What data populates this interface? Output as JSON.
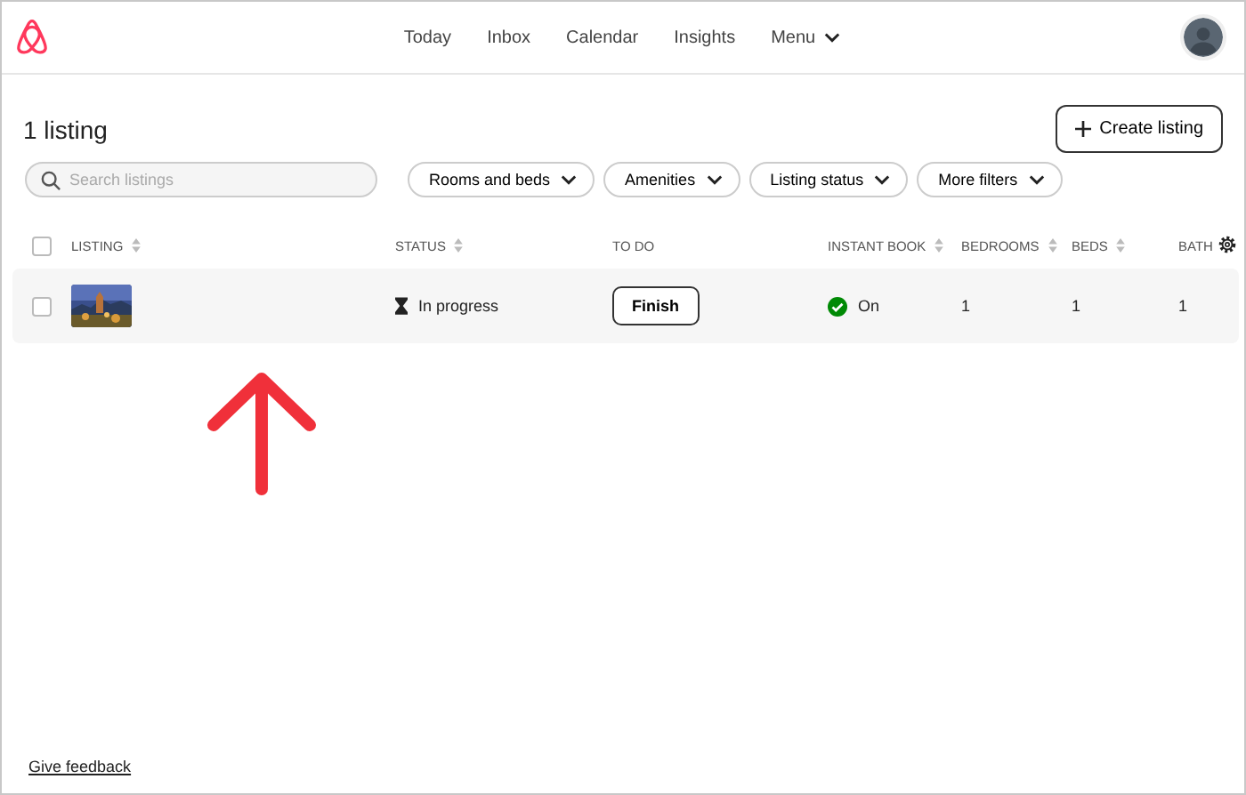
{
  "nav": [
    {
      "label": "Today"
    },
    {
      "label": "Inbox"
    },
    {
      "label": "Calendar"
    },
    {
      "label": "Insights"
    },
    {
      "label": "Menu",
      "dropdown": true
    }
  ],
  "heading": "1 listing",
  "create_button": "Create listing",
  "search": {
    "placeholder": "Search listings"
  },
  "filters": [
    "Rooms and beds",
    "Amenities",
    "Listing status",
    "More filters"
  ],
  "table": {
    "select_all_checked": false,
    "columns": [
      {
        "label": "LISTING",
        "sortable": true
      },
      {
        "label": "STATUS",
        "sortable": true
      },
      {
        "label": "TO DO",
        "sortable": false
      },
      {
        "label": "INSTANT BOOK",
        "sortable": true
      },
      {
        "label": "BEDROOMS",
        "sortable": true
      },
      {
        "label": "BEDS",
        "sortable": true
      },
      {
        "label": "BATH",
        "sortable": false
      }
    ],
    "rows": [
      {
        "checked": false,
        "status": "In progress",
        "todo": "Finish",
        "instant_book": "On",
        "instant_on": true,
        "bedrooms": "1",
        "beds": "1",
        "baths": "1"
      }
    ]
  },
  "footer_link": "Give feedback"
}
